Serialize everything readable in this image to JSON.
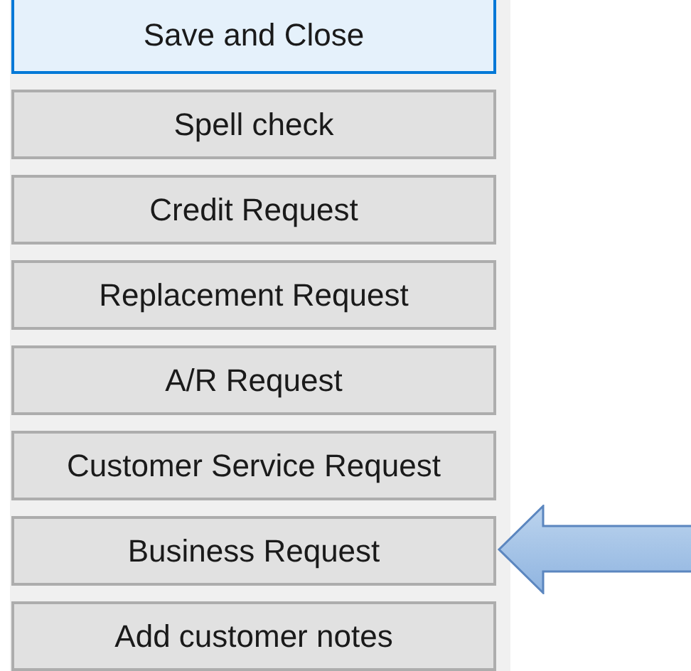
{
  "buttons": [
    {
      "label": "Save and Close",
      "focused": true,
      "pointed_at": false
    },
    {
      "label": "Spell check",
      "focused": false,
      "pointed_at": false
    },
    {
      "label": "Credit Request",
      "focused": false,
      "pointed_at": false
    },
    {
      "label": "Replacement Request",
      "focused": false,
      "pointed_at": false
    },
    {
      "label": "A/R Request",
      "focused": false,
      "pointed_at": false
    },
    {
      "label": "Customer Service Request",
      "focused": false,
      "pointed_at": false
    },
    {
      "label": "Business Request",
      "focused": false,
      "pointed_at": true
    },
    {
      "label": "Add customer notes",
      "focused": false,
      "pointed_at": false
    }
  ]
}
